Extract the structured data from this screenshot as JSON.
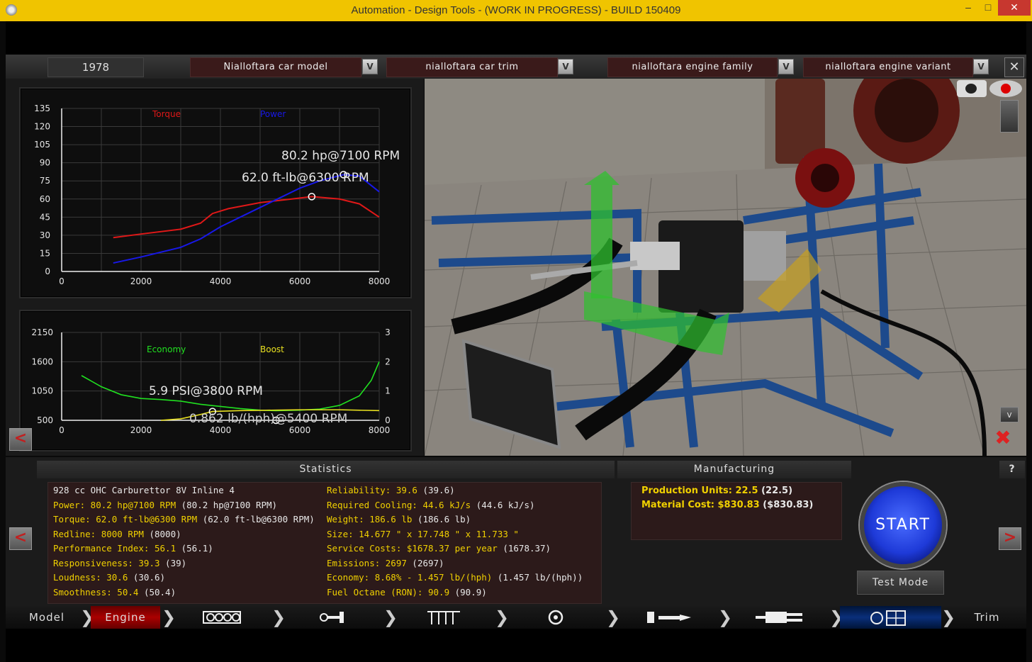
{
  "window": {
    "title": "Automation - Design Tools - (WORK IN PROGRESS) - BUILD 150409",
    "min_label": "–",
    "max_label": "□",
    "close_label": "✕"
  },
  "topbar": {
    "year": "1978",
    "car_model": "Nialloftara car  model",
    "car_trim": "nialloftara car trim",
    "engine_family": "nialloftara engine family",
    "engine_variant": "nialloftara engine variant",
    "dropdown_label": "V",
    "close_label": "✕"
  },
  "power_chart": {
    "legend_torque": "Torque",
    "legend_power": "Power",
    "annot_power": "80.2 hp@7100 RPM",
    "annot_torque": "62.0 ft-lb@6300 RPM",
    "y_ticks": [
      "135",
      "120",
      "105",
      "90",
      "75",
      "60",
      "45",
      "30",
      "15",
      "0"
    ],
    "x_ticks": [
      "0",
      "2000",
      "4000",
      "6000",
      "8000"
    ],
    "colors": {
      "torque": "#e01818",
      "power": "#1818e8"
    }
  },
  "economy_chart": {
    "legend_economy": "Economy",
    "legend_boost": "Boost",
    "annot_boost": "5.9 PSI@3800 RPM",
    "annot_economy": "0.862 lb/(hph)@5400 RPM",
    "y_ticks_left": [
      "2150",
      "1600",
      "1050",
      "500"
    ],
    "y_ticks_right": [
      "3",
      "2",
      "1",
      "0"
    ],
    "x_ticks": [
      "0",
      "2000",
      "4000",
      "6000",
      "8000"
    ],
    "colors": {
      "economy": "#20e020",
      "boost": "#e8e020"
    }
  },
  "chart_data": [
    {
      "type": "line",
      "xlim": [
        0,
        8000
      ],
      "ylim": [
        0,
        135
      ],
      "series": [
        {
          "name": "Torque",
          "x": [
            1300,
            2000,
            3000,
            3500,
            3800,
            4200,
            5000,
            5800,
            6300,
            7000,
            7500,
            8000
          ],
          "y": [
            28,
            31,
            35,
            40,
            48,
            52,
            57,
            60,
            62,
            60,
            56,
            45
          ]
        },
        {
          "name": "Power",
          "x": [
            1300,
            2000,
            3000,
            3500,
            4000,
            4500,
            5000,
            5500,
            6000,
            6500,
            7100,
            7500,
            8000
          ],
          "y": [
            7,
            12,
            20,
            27,
            37,
            45,
            53,
            61,
            69,
            75,
            80.2,
            79,
            66
          ]
        }
      ]
    },
    {
      "type": "line",
      "xlim": [
        0,
        8000
      ],
      "ylim_left": [
        500,
        2150
      ],
      "ylim_right": [
        0,
        3
      ],
      "series": [
        {
          "name": "Economy",
          "x": [
            500,
            1000,
            1500,
            2000,
            2500,
            3000,
            3500,
            4000,
            4500,
            5000,
            5400,
            6000,
            6500,
            7000,
            7500,
            7800,
            8000
          ],
          "y": [
            1340,
            1130,
            980,
            910,
            890,
            860,
            800,
            760,
            720,
            690,
            680,
            690,
            710,
            780,
            960,
            1250,
            1600
          ]
        },
        {
          "name": "Boost",
          "x": [
            2500,
            3000,
            3500,
            3800,
            4500,
            5000,
            5500,
            6000,
            7000,
            8000
          ],
          "y": [
            0,
            0.05,
            0.2,
            0.3,
            0.33,
            0.34,
            0.35,
            0.36,
            0.36,
            0.33
          ]
        }
      ]
    }
  ],
  "statistics": {
    "header": "Statistics",
    "left": [
      {
        "label": "928 cc OHC Carburettor 8V Inline 4",
        "value": "",
        "white": true
      },
      {
        "label": "Power: 80.2 hp@7100 RPM",
        "value": "(80.2 hp@7100 RPM)"
      },
      {
        "label": "Torque: 62.0 ft-lb@6300 RPM",
        "value": "(62.0 ft-lb@6300 RPM)"
      },
      {
        "label": "Redline: 8000 RPM",
        "value": "(8000)"
      },
      {
        "label": "Performance Index: 56.1",
        "value": "(56.1)"
      },
      {
        "label": "Responsiveness: 39.3",
        "value": "(39)"
      },
      {
        "label": "Loudness: 30.6",
        "value": "(30.6)"
      },
      {
        "label": "Smoothness: 50.4",
        "value": "(50.4)"
      }
    ],
    "right": [
      {
        "label": "Reliability: 39.6",
        "value": "(39.6)"
      },
      {
        "label": "Required Cooling: 44.6 kJ/s",
        "value": "(44.6 kJ/s)"
      },
      {
        "label": "Weight: 186.6 lb",
        "value": "(186.6 lb)"
      },
      {
        "label": "Size: 14.677 \" x 17.748 \" x 11.733 \"",
        "value": ""
      },
      {
        "label": "Service Costs: $1678.37 per year",
        "value": "(1678.37)"
      },
      {
        "label": "Emissions: 2697",
        "value": "(2697)"
      },
      {
        "label": "Economy: 8.68% - 1.457 lb/(hph)",
        "value": "(1.457 lb/(hph))"
      },
      {
        "label": "Fuel Octane (RON): 90.9",
        "value": "(90.9)"
      }
    ]
  },
  "manufacturing": {
    "header": "Manufacturing",
    "production_label": "Production Units: 22.5",
    "production_value": "(22.5)",
    "material_label": "Material Cost: $830.83",
    "material_value": "($830.83)"
  },
  "controls": {
    "help_label": "?",
    "start_label": "START",
    "test_mode_label": "Test Mode",
    "prev_label": "<",
    "next_label": ">"
  },
  "nav": {
    "model_label": "Model",
    "engine_label": "Engine",
    "trim_label": "Trim",
    "chevron": "❯",
    "icons": [
      "block-icon",
      "crank-icon",
      "valvetrain-icon",
      "turbo-icon",
      "fuel-icon",
      "exhaust-icon",
      "dyno-icon"
    ]
  }
}
